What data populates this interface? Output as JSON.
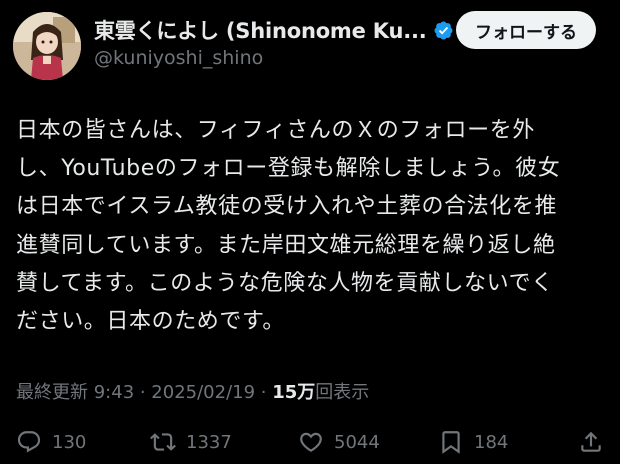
{
  "author": {
    "display_name": "東雲くによし (Shinonome Ku...",
    "handle": "@kuniyoshi_shino",
    "avatar_icon": "avatar-image",
    "verified_icon": "verified-badge-icon"
  },
  "follow_button": {
    "label": "フォローする"
  },
  "tweet": {
    "lines": [
      "日本の皆さんは、フィフィさんのＸのフォローを外",
      "し、YouTubeのフォロー登録も解除しましょう。彼女",
      "は日本でイスラム教徒の受け入れや土葬の合法化を推",
      "進賛同しています。また岸田文雄元総理を繰り返し絶",
      "賛してます。このような危険な人物を貢献しないでく",
      "ださい。日本のためです。"
    ]
  },
  "meta": {
    "prefix": "最終更新 9:43 · 2025/02/19 · ",
    "views_count": "15万",
    "views_label": "回表示"
  },
  "actions": {
    "reply": {
      "icon": "reply-icon",
      "count": "130"
    },
    "repost": {
      "icon": "repost-icon",
      "count": "1337"
    },
    "like": {
      "icon": "like-icon",
      "count": "5044"
    },
    "bookmark": {
      "icon": "bookmark-icon",
      "count": "184"
    },
    "share": {
      "icon": "share-icon"
    }
  },
  "colors": {
    "background": "#000000",
    "text": "#e7e9ea",
    "secondary": "#71767b",
    "verified_blue": "#1d9bf0",
    "button_bg": "#eff3f4"
  }
}
